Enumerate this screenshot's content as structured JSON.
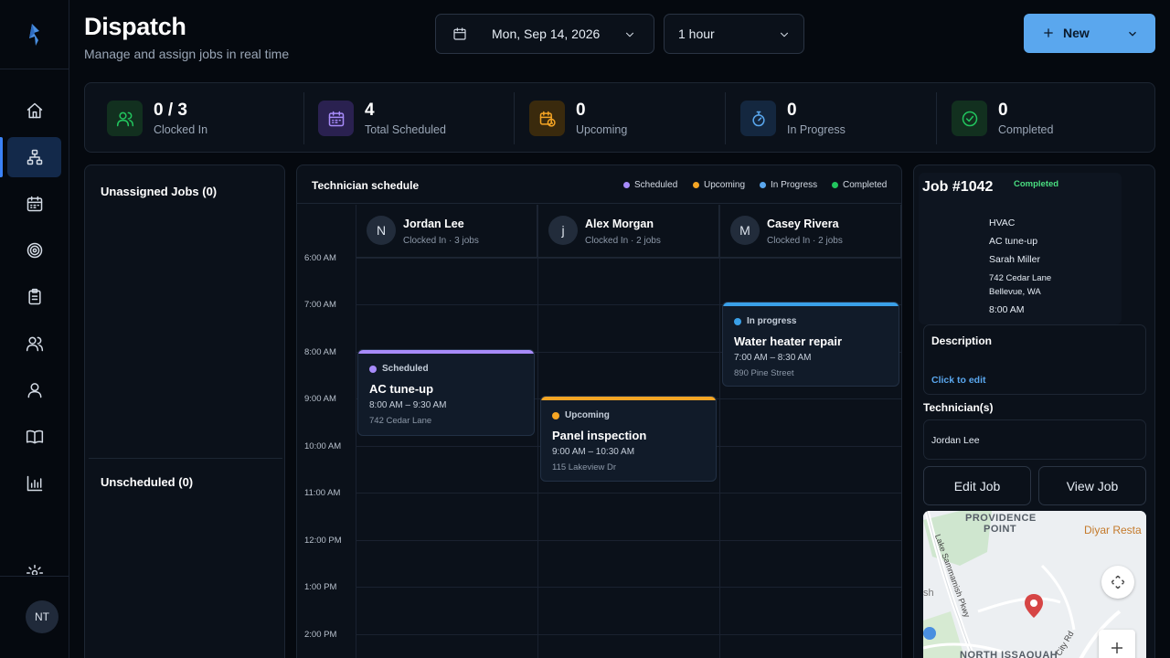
{
  "header": {
    "title": "Dispatch",
    "subtitle": "Manage and assign jobs in real time",
    "date_value": "Mon, Sep 14, 2026",
    "interval_value": "1 hour",
    "new_label": "New"
  },
  "sidebar": {
    "items": [
      {
        "name": "home",
        "icon": "home-icon"
      },
      {
        "name": "dispatch",
        "icon": "hierarchy-icon",
        "active": true
      },
      {
        "name": "calendar",
        "icon": "calendar-icon"
      },
      {
        "name": "target",
        "icon": "target-icon"
      },
      {
        "name": "clipboard",
        "icon": "clipboard-icon"
      },
      {
        "name": "team",
        "icon": "users-icon"
      },
      {
        "name": "profile",
        "icon": "user-icon"
      },
      {
        "name": "docs",
        "icon": "book-icon"
      },
      {
        "name": "reports",
        "icon": "bar-chart-icon"
      }
    ],
    "user_initials": "NT"
  },
  "stats": [
    {
      "value": "0 / 3",
      "label": "Clocked In",
      "color": "#22c55e"
    },
    {
      "value": "4",
      "label": "Total Scheduled",
      "color": "#a78bfa"
    },
    {
      "value": "0",
      "label": "Upcoming",
      "color": "#f5a524"
    },
    {
      "value": "0",
      "label": "In Progress",
      "color": "#5aa7ee"
    },
    {
      "value": "0",
      "label": "Completed",
      "color": "#22c55e"
    }
  ],
  "left_panel": {
    "unassigned_title": "Unassigned Jobs (0)",
    "unscheduled_title": "Unscheduled (0)"
  },
  "schedule": {
    "title": "Technician schedule",
    "legend": [
      {
        "label": "Scheduled",
        "color": "#a78bfa"
      },
      {
        "label": "Upcoming",
        "color": "#f5a524"
      },
      {
        "label": "In Progress",
        "color": "#5aa7ee"
      },
      {
        "label": "Completed",
        "color": "#22c55e"
      }
    ],
    "technicians": [
      {
        "initial": "N",
        "name": "Jordan Lee",
        "meta": "Clocked In · 3 jobs"
      },
      {
        "initial": "j",
        "name": "Alex Morgan",
        "meta": "Clocked In · 2 jobs"
      },
      {
        "initial": "M",
        "name": "Casey Rivera",
        "meta": "Clocked In · 2 jobs"
      }
    ],
    "times": [
      "6:00 AM",
      "7:00 AM",
      "8:00 AM",
      "9:00 AM",
      "10:00 AM",
      "11:00 AM",
      "12:00 PM",
      "1:00 PM",
      "2:00 PM"
    ],
    "jobs": [
      {
        "status": "Scheduled",
        "title": "AC tune-up",
        "time": "8:00 AM – 9:30 AM",
        "address": "742 Cedar Lane",
        "color": "#a78bfa"
      },
      {
        "status": "Upcoming",
        "title": "Panel inspection",
        "time": "9:00 AM – 10:30 AM",
        "address": "115 Lakeview Dr",
        "color": "#f5a524"
      },
      {
        "status": "In progress",
        "title": "Water heater repair",
        "time": "7:00 AM – 8:30 AM",
        "address": "890 Pine Street",
        "color": "#3aa0e8"
      }
    ]
  },
  "job_detail": {
    "id": "Job #1042",
    "status": "Completed",
    "category": "HVAC",
    "service": "AC tune-up",
    "customer": "Sarah Miller",
    "address_line1": "742 Cedar Lane",
    "address_line2": "Bellevue, WA",
    "time": "8:00 AM",
    "description_label": "Description",
    "description_action": "Click to edit",
    "technicians_label": "Technician(s)",
    "technician": "Jordan Lee",
    "edit_label": "Edit Job",
    "view_label": "View Job",
    "map": {
      "labels": [
        "PROVIDENCE",
        "POINT",
        "Diyar Resta",
        "Lake Sammamish Pkwy",
        "NORTH ISSAQUAH",
        "City Rd",
        "sh"
      ]
    }
  }
}
